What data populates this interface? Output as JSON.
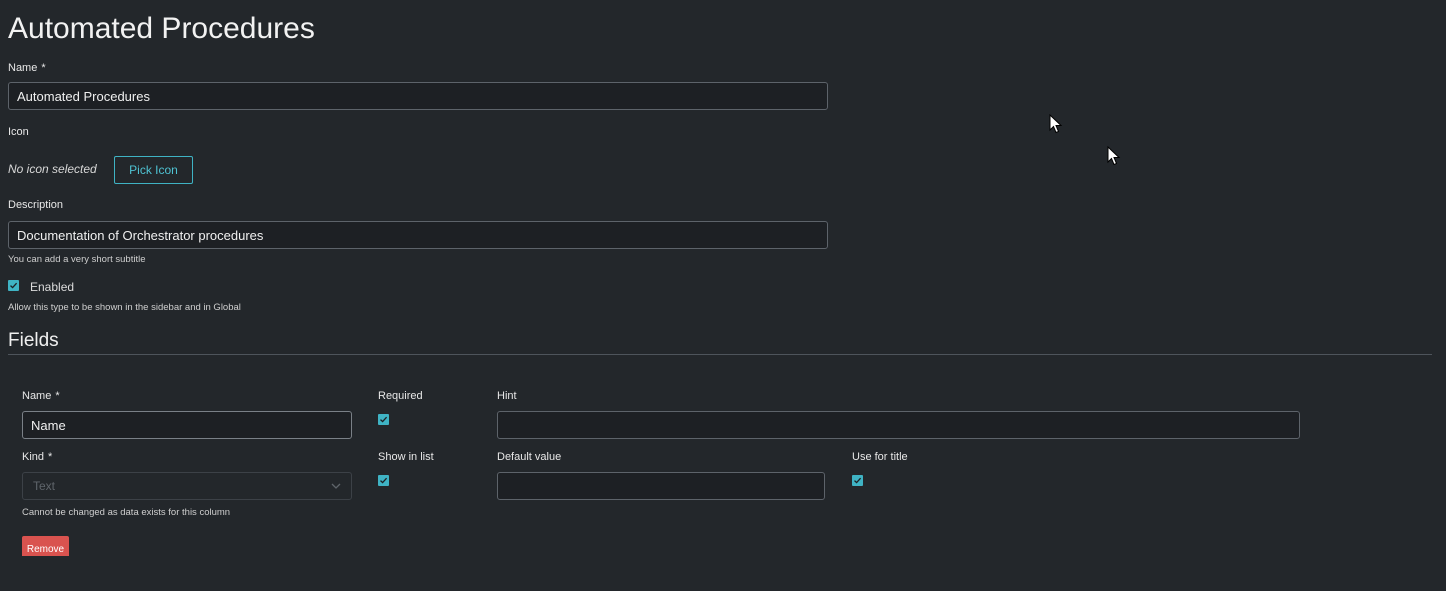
{
  "page": {
    "title": "Automated Procedures"
  },
  "form": {
    "name": {
      "label": "Name",
      "required_mark": "*",
      "value": "Automated Procedures"
    },
    "icon": {
      "label": "Icon",
      "status": "No icon selected",
      "pick_button": "Pick Icon"
    },
    "description": {
      "label": "Description",
      "value": "Documentation of Orchestrator procedures",
      "help": "You can add a very short subtitle"
    },
    "enabled": {
      "label": "Enabled",
      "checked": true,
      "help": "Allow this type to be shown in the sidebar and in Global"
    }
  },
  "fields_section": {
    "title": "Fields",
    "field": {
      "name": {
        "label": "Name",
        "required_mark": "*",
        "value": "Name"
      },
      "required": {
        "label": "Required",
        "checked": true
      },
      "hint": {
        "label": "Hint",
        "value": ""
      },
      "kind": {
        "label": "Kind",
        "required_mark": "*",
        "selected": "Text",
        "help": "Cannot be changed as data exists for this column"
      },
      "show_in_list": {
        "label": "Show in list",
        "checked": true
      },
      "default_value": {
        "label": "Default value",
        "value": ""
      },
      "use_for_title": {
        "label": "Use for title",
        "checked": true
      },
      "remove_button": "Remove"
    }
  },
  "colors": {
    "background": "#23272b",
    "accent": "#3fb3c4",
    "danger": "#d9534f",
    "input_border": "#5d636a"
  },
  "icons": [
    "check-icon",
    "chevron-down-icon",
    "mouse-cursor-icon"
  ]
}
